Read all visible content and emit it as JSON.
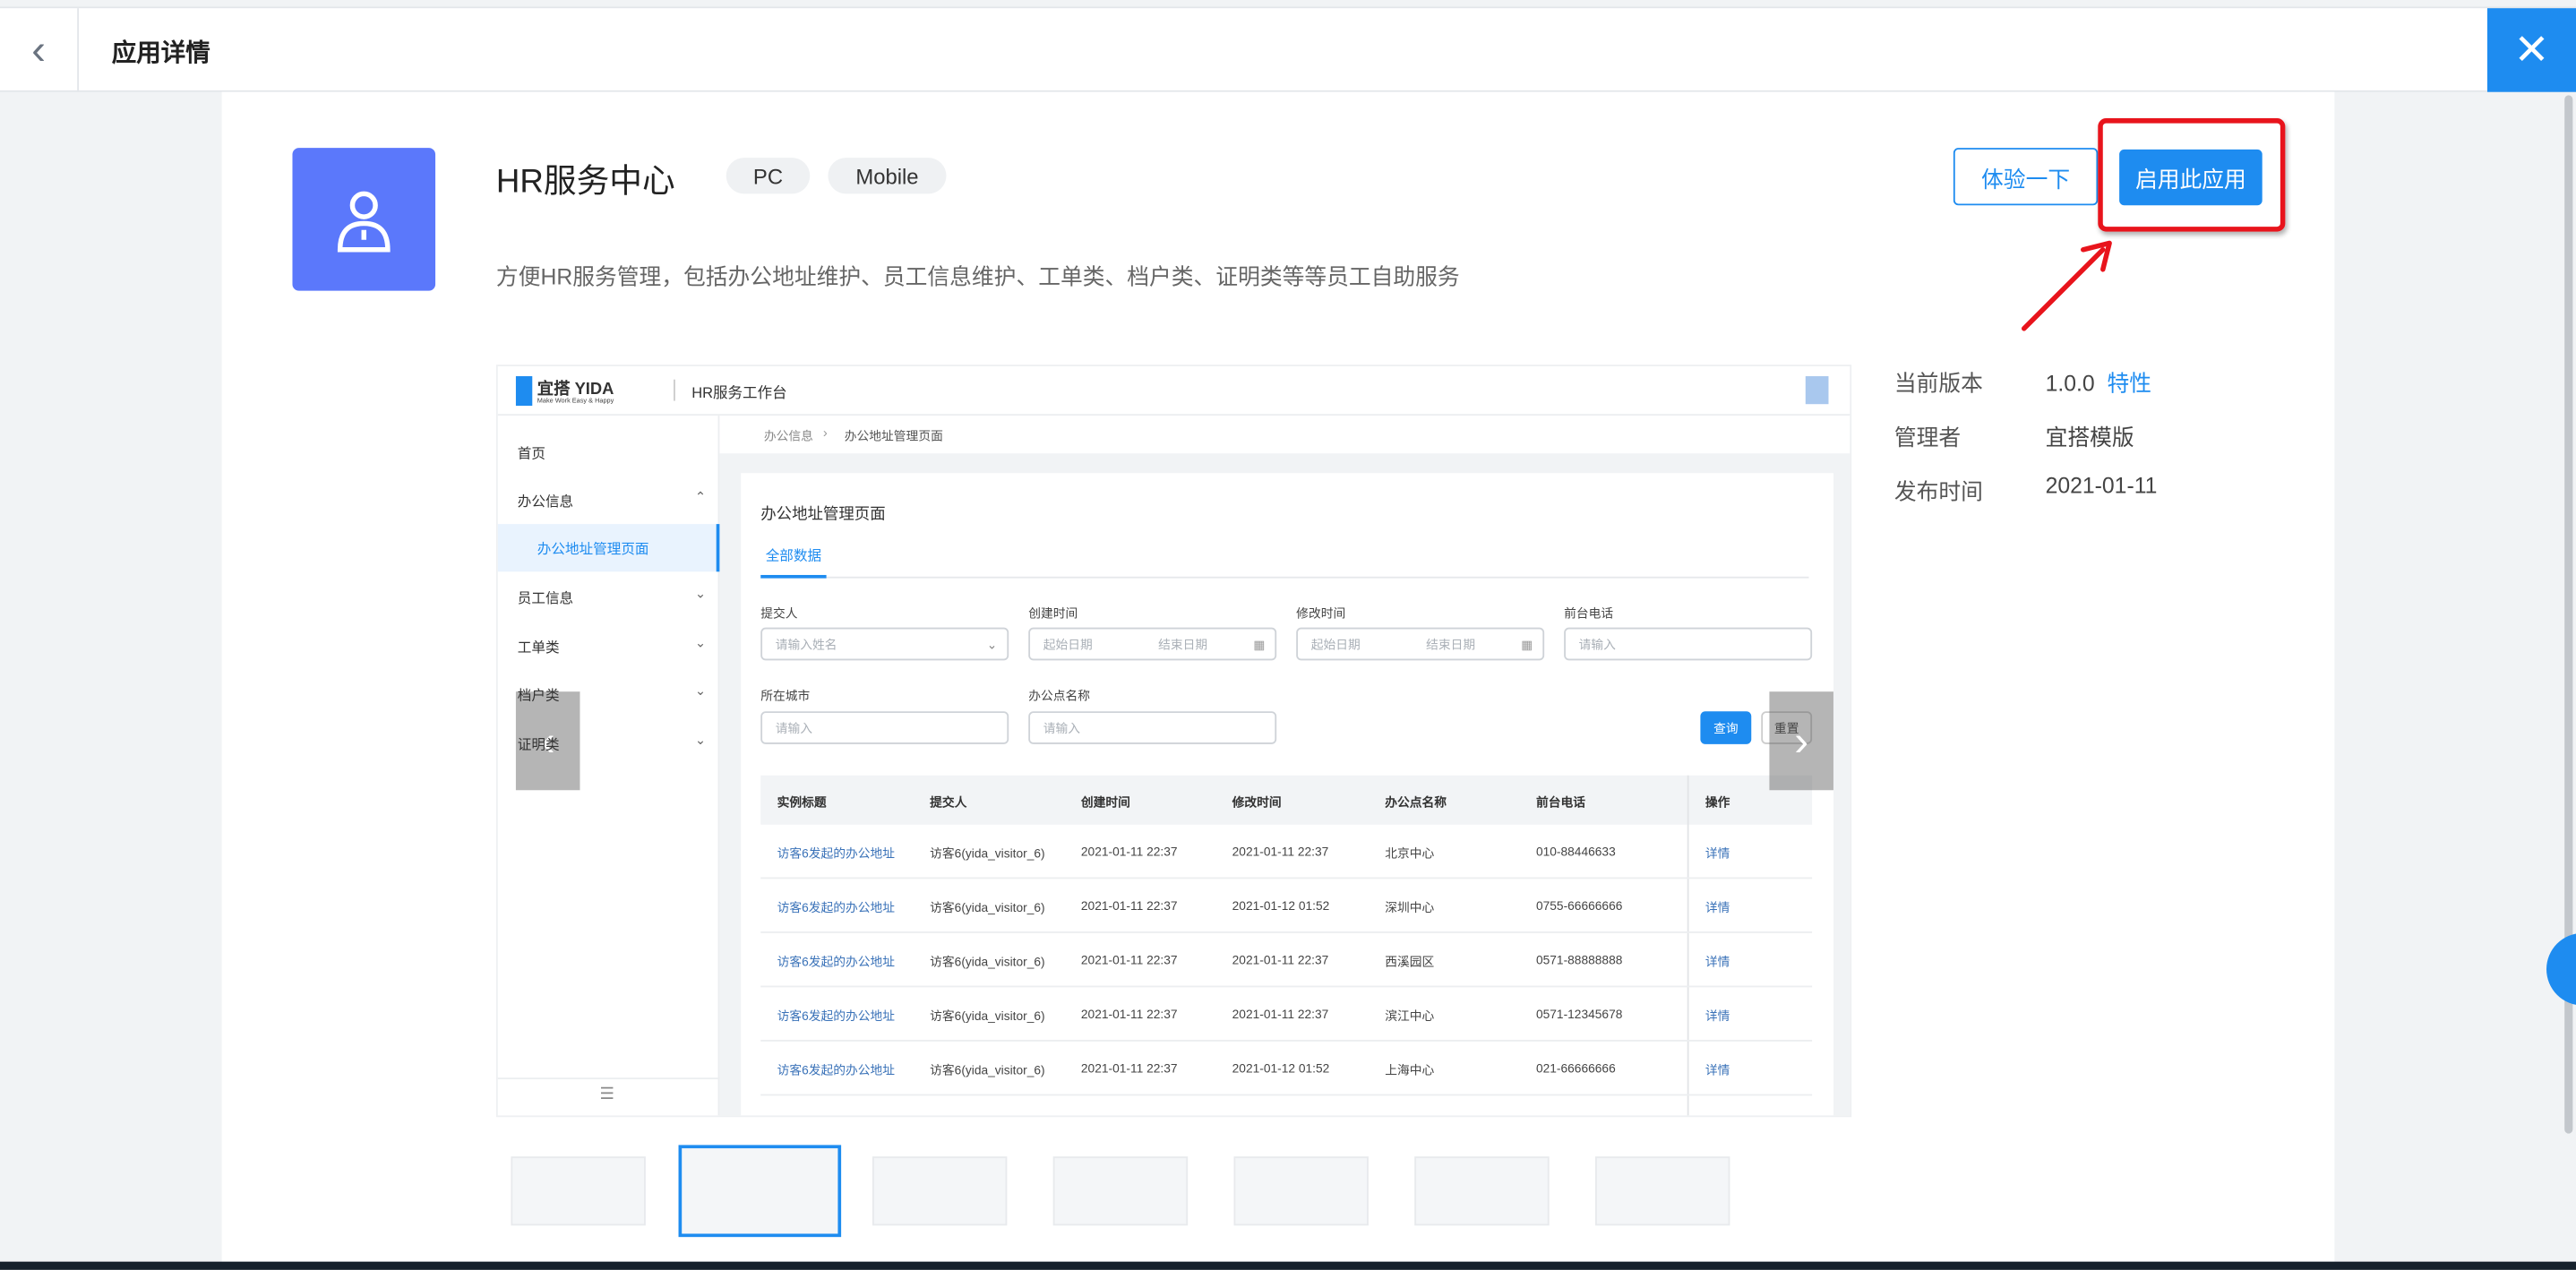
{
  "header": {
    "title": "应用详情",
    "back_icon": "chevron-left-icon",
    "close_icon": "close-icon",
    "accent": "#1e8cf0"
  },
  "app": {
    "name": "HR服务中心",
    "tags": [
      "PC",
      "Mobile"
    ],
    "description": "方便HR服务管理，包括办公地址维护、员工信息维护、工单类、档户类、证明类等等员工自助服务",
    "icon": "user-icon",
    "icon_color": "#5b78fb",
    "try_label": "体验一下",
    "enable_label": "启用此应用"
  },
  "info": {
    "version_label": "当前版本",
    "version": "1.0.0",
    "features_link": "特性",
    "admin_label": "管理者",
    "admin": "宜搭模版",
    "date_label": "发布时间",
    "date": "2021-01-11"
  },
  "annotation_color": "#e8141c",
  "preview": {
    "logo_text": "宜搭 YIDA",
    "logo_slogan": "Make Work Easy & Happy",
    "workspace": "HR服务工作台",
    "sidebar": [
      "首页",
      "办公信息",
      "办公地址管理页面",
      "员工信息",
      "工单类",
      "档户类",
      "证明类"
    ],
    "breadcrumb": [
      "办公信息",
      "办公地址管理页面"
    ],
    "page_title": "办公地址管理页面",
    "tab": "全部数据",
    "filters": [
      {
        "label": "提交人",
        "placeholder": "请输入姓名"
      },
      {
        "label": "创建时间",
        "start": "起始日期",
        "end": "结束日期"
      },
      {
        "label": "修改时间",
        "start": "起始日期",
        "end": "结束日期"
      },
      {
        "label": "前台电话",
        "placeholder": "请输入"
      },
      {
        "label": "所在城市",
        "placeholder": "请输入"
      },
      {
        "label": "办公点名称",
        "placeholder": "请输入"
      }
    ],
    "query_label": "查询",
    "reset_label": "重置",
    "columns": [
      "实例标题",
      "提交人",
      "创建时间",
      "修改时间",
      "办公点名称",
      "前台电话",
      "操作"
    ],
    "rows": [
      [
        "访客6发起的办公地址",
        "访客6(yida_visitor_6)",
        "2021-01-11 22:37",
        "2021-01-11 22:37",
        "北京中心",
        "010-88446633",
        "详情"
      ],
      [
        "访客6发起的办公地址",
        "访客6(yida_visitor_6)",
        "2021-01-11 22:37",
        "2021-01-12 01:52",
        "深圳中心",
        "0755-66666666",
        "详情"
      ],
      [
        "访客6发起的办公地址",
        "访客6(yida_visitor_6)",
        "2021-01-11 22:37",
        "2021-01-11 22:37",
        "西溪园区",
        "0571-88888888",
        "详情"
      ],
      [
        "访客6发起的办公地址",
        "访客6(yida_visitor_6)",
        "2021-01-11 22:37",
        "2021-01-11 22:37",
        "滨江中心",
        "0571-12345678",
        "详情"
      ],
      [
        "访客6发起的办公地址",
        "访客6(yida_visitor_6)",
        "2021-01-11 22:37",
        "2021-01-12 01:52",
        "上海中心",
        "021-66666666",
        "详情"
      ]
    ]
  },
  "carousel": {
    "prev_icon": "chevron-left-icon",
    "next_icon": "chevron-right-icon",
    "thumbnail_count": 7,
    "selected_index": 1
  }
}
